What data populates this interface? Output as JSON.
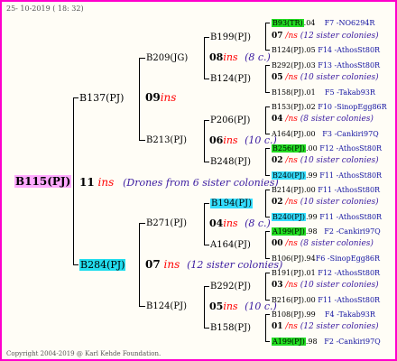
{
  "header_date": "25- 10-2019 ( 18: 32)",
  "footer": "Copyright 2004-2019 @ Karl Kehde Foundation.",
  "root": {
    "id": "B115(PJ)",
    "count": "11",
    "ins": "ins",
    "note": "(Drones from 6 sister colonies)"
  },
  "p": {
    "id": "B137(PJ)",
    "count": "09",
    "ins": "ins"
  },
  "m": {
    "id": "B284(PJ)",
    "count": "07",
    "ins": "ins",
    "note": "(12 sister colonies)"
  },
  "pp": {
    "id": "B209(JG)",
    "count": "08",
    "ins": "ins",
    "note": "(8 c.)"
  },
  "pm": {
    "id": "B213(PJ)",
    "count": "06",
    "ins": "ins",
    "note": "(10 c.)"
  },
  "mp": {
    "id": "B271(PJ)",
    "count": "04",
    "ins": "ins",
    "note": "(8 c.)"
  },
  "mm": {
    "id": "B124(PJ)",
    "count": "05",
    "ins": "ins",
    "note": "(10 c.)"
  },
  "g3": [
    {
      "id": "B199(PJ)",
      "count": "07",
      "ins": "/ns",
      "note": "(12 sister colonies)"
    },
    {
      "id": "B124(PJ)",
      "count": "05",
      "ins": "/ns",
      "note": "(10 sister colonies)"
    },
    {
      "id": "P206(PJ)",
      "count": "04",
      "ins": "/ns",
      "note": "(8 sister colonies)"
    },
    {
      "id": "B248(PJ)",
      "count": "02",
      "ins": "/ns",
      "note": "(10 sister colonies)"
    },
    {
      "id": "B194(PJ)",
      "count": "02",
      "ins": "/ns",
      "note": "(10 sister colonies)"
    },
    {
      "id": "A164(PJ)",
      "count": "00",
      "ins": "/ns",
      "note": "(8 sister colonies)"
    },
    {
      "id": "B292(PJ)",
      "count": "03",
      "ins": "/ns",
      "note": "(10 sister colonies)"
    },
    {
      "id": "B158(PJ)",
      "count": "01",
      "ins": "/ns",
      "note": "(12 sister colonies)"
    }
  ],
  "g4": [
    {
      "id": "B93(TR)",
      "yr": ".04",
      "info": "F7 -NO6294R"
    },
    {
      "id": "B124(PJ)",
      "yr": ".05",
      "info": "F14 -AthosSt80R"
    },
    {
      "id": "B292(PJ)",
      "yr": ".03",
      "info": "F13 -AthosSt80R"
    },
    {
      "id": "B158(PJ)",
      "yr": ".01",
      "info": "F5 -Takab93R"
    },
    {
      "id": "B153(PJ)",
      "yr": ".02",
      "info": "F10 -SinopEgg86R"
    },
    {
      "id": "A164(PJ)",
      "yr": ".00",
      "info": "F3 -Cankiri97Q"
    },
    {
      "id": "B256(PJ)",
      "yr": ".00",
      "info": "F12 -AthosSt80R"
    },
    {
      "id": "B240(PJ)",
      "yr": ".99",
      "info": "F11 -AthosSt80R"
    },
    {
      "id": "B214(PJ)",
      "yr": ".00",
      "info": "F11 -AthosSt80R"
    },
    {
      "id": "B240(PJ)",
      "yr": ".99",
      "info": "F11 -AthosSt80R"
    },
    {
      "id": "A199(PJ)",
      "yr": ".98",
      "info": "F2 -Cankiri97Q"
    },
    {
      "id": "B106(PJ)",
      "yr": ".94",
      "info": "F6 -SinopEgg86R"
    },
    {
      "id": "B191(PJ)",
      "yr": ".01",
      "info": "F12 -AthosSt80R"
    },
    {
      "id": "B216(PJ)",
      "yr": ".00",
      "info": "F11 -AthosSt80R"
    },
    {
      "id": "B108(PJ)",
      "yr": ".99",
      "info": "F4 -Takab93R"
    },
    {
      "id": "A199(PJ)",
      "yr": ".98",
      "info": "F2 -Cankiri97Q"
    }
  ]
}
